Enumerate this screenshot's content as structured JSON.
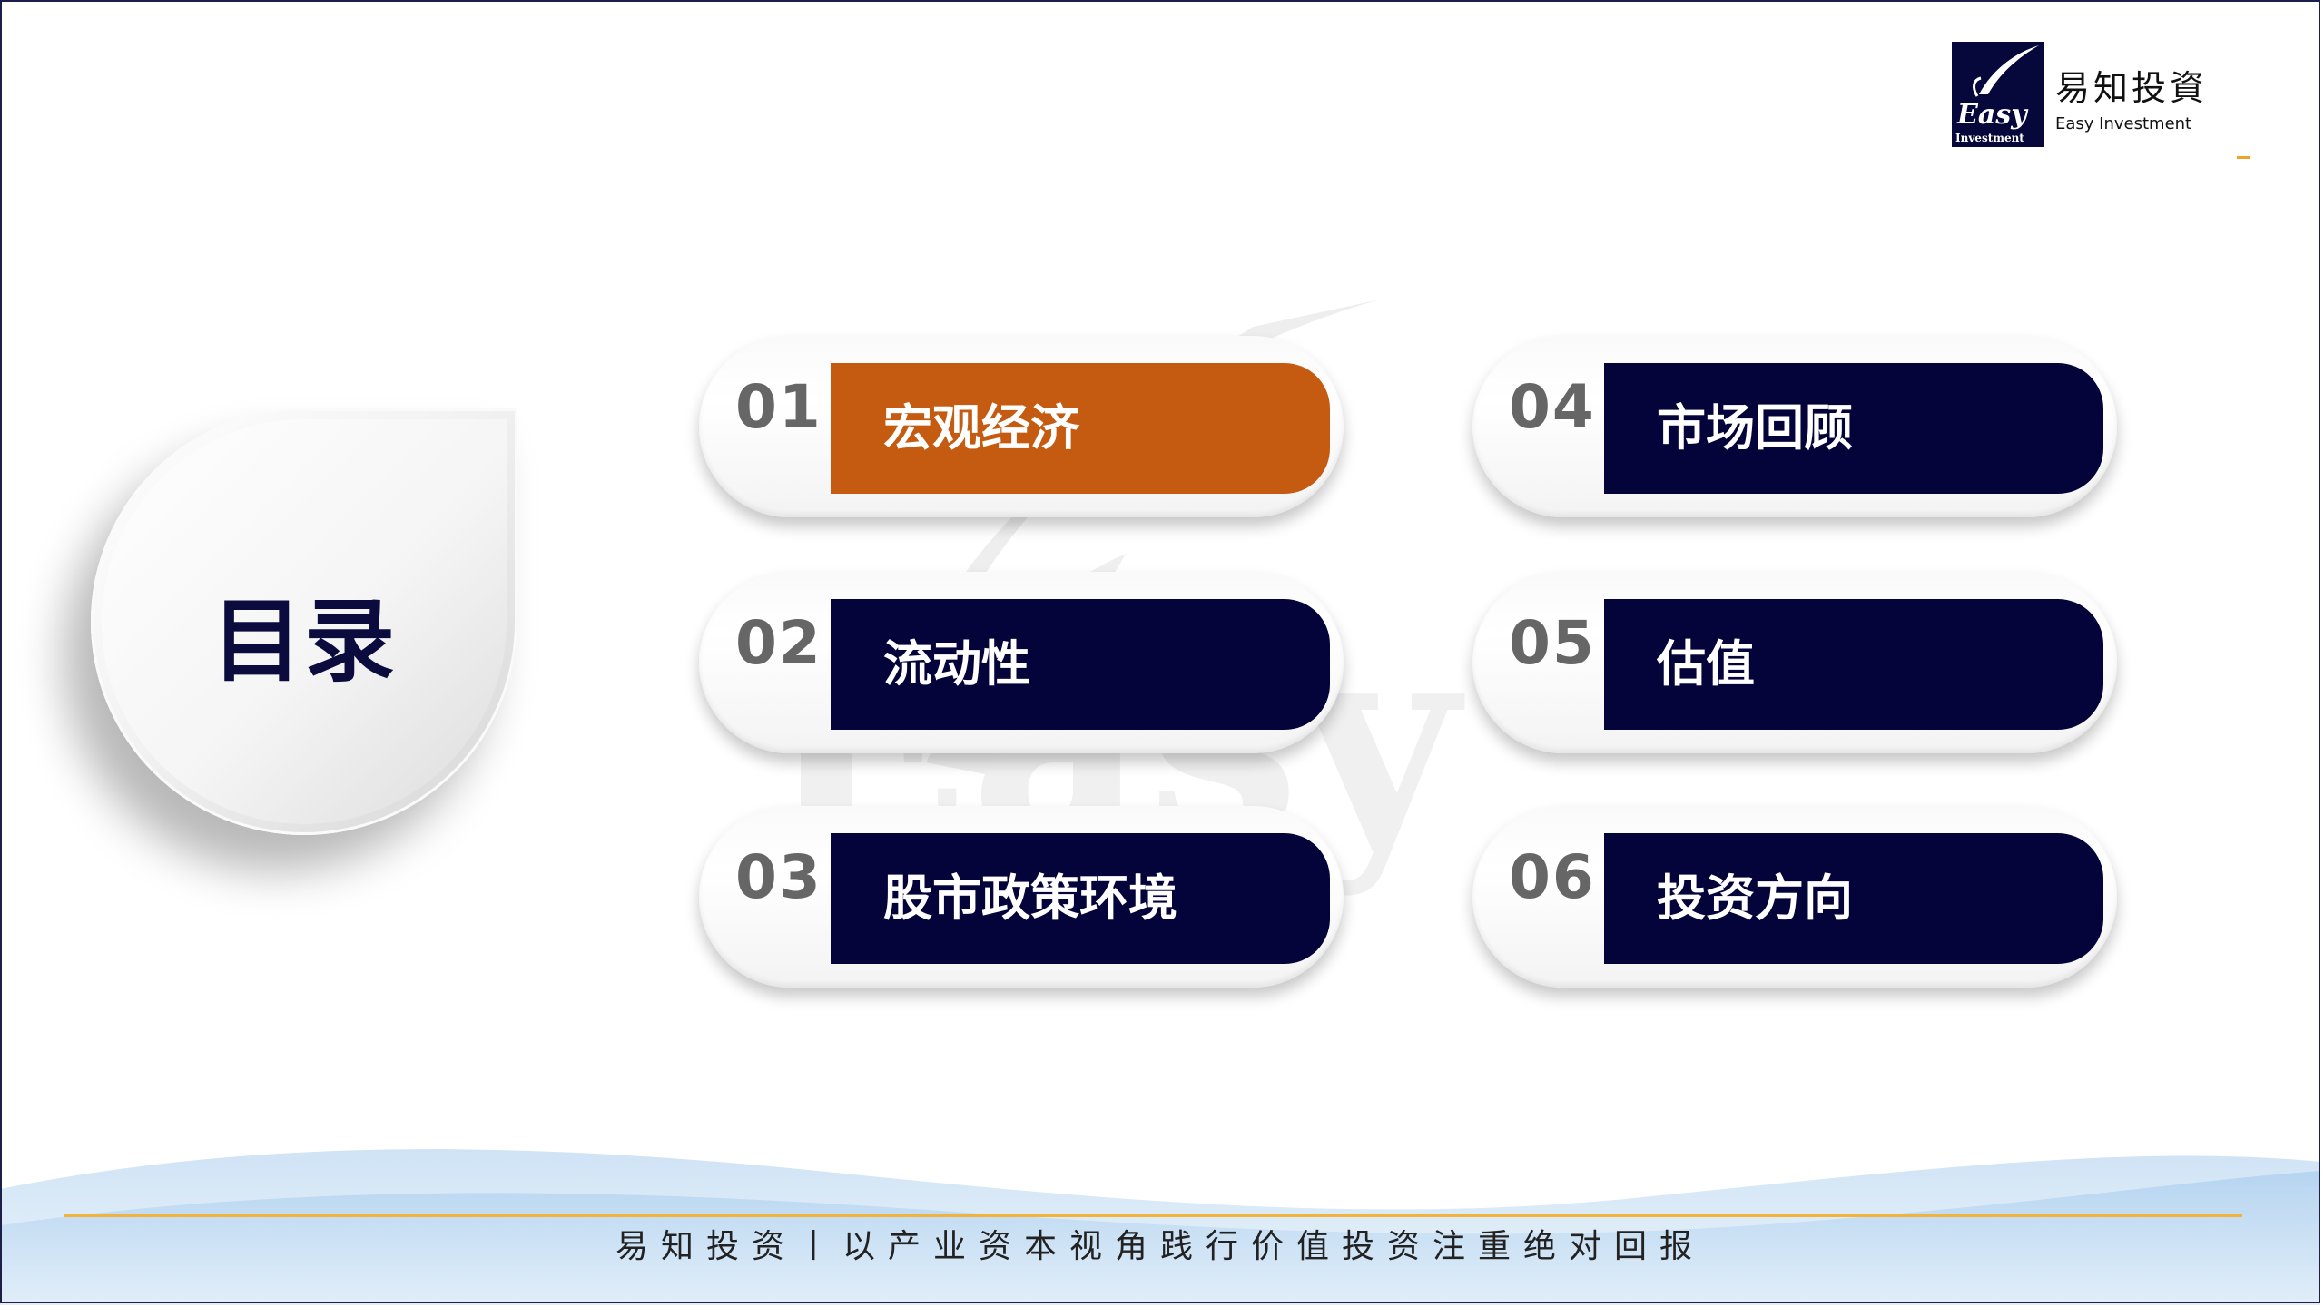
{
  "logo": {
    "mark_text": "Easy",
    "mark_subtext": "Investment",
    "cn": "易知投資",
    "en": "Easy Investment"
  },
  "title": "目录",
  "menu": [
    {
      "num": "01",
      "label": "宏观经济",
      "active": true
    },
    {
      "num": "02",
      "label": "流动性",
      "active": false
    },
    {
      "num": "03",
      "label": "股市政策环境",
      "active": false
    },
    {
      "num": "04",
      "label": "市场回顾",
      "active": false
    },
    {
      "num": "05",
      "label": "估值",
      "active": false
    },
    {
      "num": "06",
      "label": "投资方向",
      "active": false
    }
  ],
  "footer": {
    "text": "易知投资丨以产业资本视角践行价值投资注重绝对回报"
  },
  "colors": {
    "navy": "#04043a",
    "accent": "#c55a11",
    "gold": "#f0b43a"
  }
}
